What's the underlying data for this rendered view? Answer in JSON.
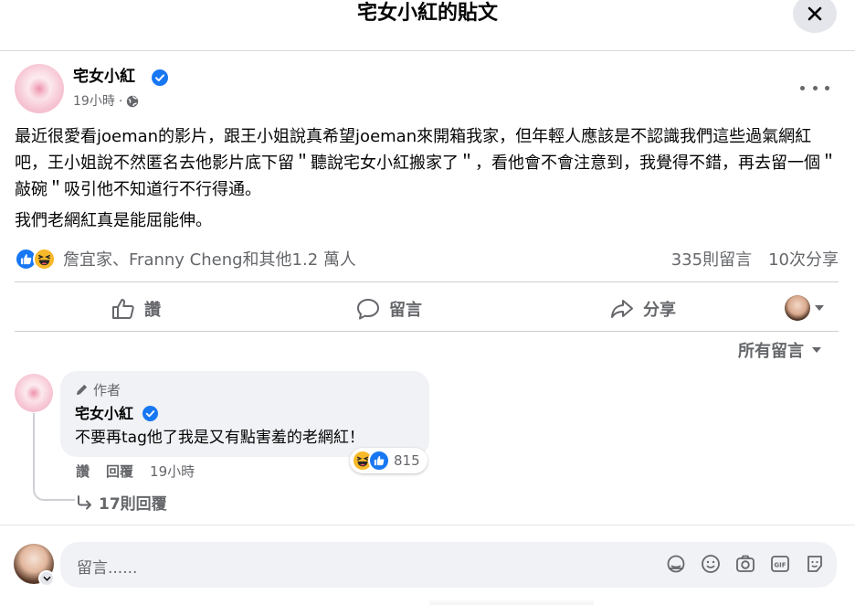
{
  "header": {
    "title": "宅女小紅的貼文"
  },
  "post": {
    "author": "宅女小紅",
    "time": "19小時",
    "dot": "·",
    "paragraphs": [
      "最近很愛看joeman的影片，跟王小姐說真希望joeman來開箱我家，但年輕人應該是不認識我們這些過氣網紅吧，王小姐說不然匿名去他影片底下留＂聽說宅女小紅搬家了＂，看他會不會注意到，我覺得不錯，再去留一個＂敲碗＂吸引他不知道行不行得通。",
      "我們老網紅真是能屈能伸。"
    ],
    "reaction_names": "詹宜家、Franny Cheng和其他1.2 萬人",
    "comments_count": "335則留言",
    "shares_count": "10次分享"
  },
  "actions": {
    "like": "讚",
    "comment": "留言",
    "share": "分享"
  },
  "sort": {
    "label": "所有留言"
  },
  "comment": {
    "author_badge": "作者",
    "author": "宅女小紅",
    "text": "不要再tag他了我是又有點害羞的老網紅！",
    "reaction_count": "815",
    "like": "讚",
    "reply": "回覆",
    "time": "19小時",
    "replies": "17則回覆"
  },
  "composer": {
    "placeholder": "留言......"
  },
  "colors": {
    "blue": "#1877f2",
    "gray_text": "#65676b",
    "bubble": "#f0f2f5"
  },
  "icons": [
    "close-icon",
    "verified-icon",
    "globe-icon",
    "more-icon",
    "like-reaction-icon",
    "haha-reaction-icon",
    "thumbs-up-icon",
    "comment-icon",
    "share-icon",
    "chevron-down-icon",
    "pencil-icon",
    "reply-arrow-icon",
    "sticker-icon",
    "emoji-icon",
    "camera-icon",
    "gif-icon",
    "avatar-sticker-icon"
  ]
}
